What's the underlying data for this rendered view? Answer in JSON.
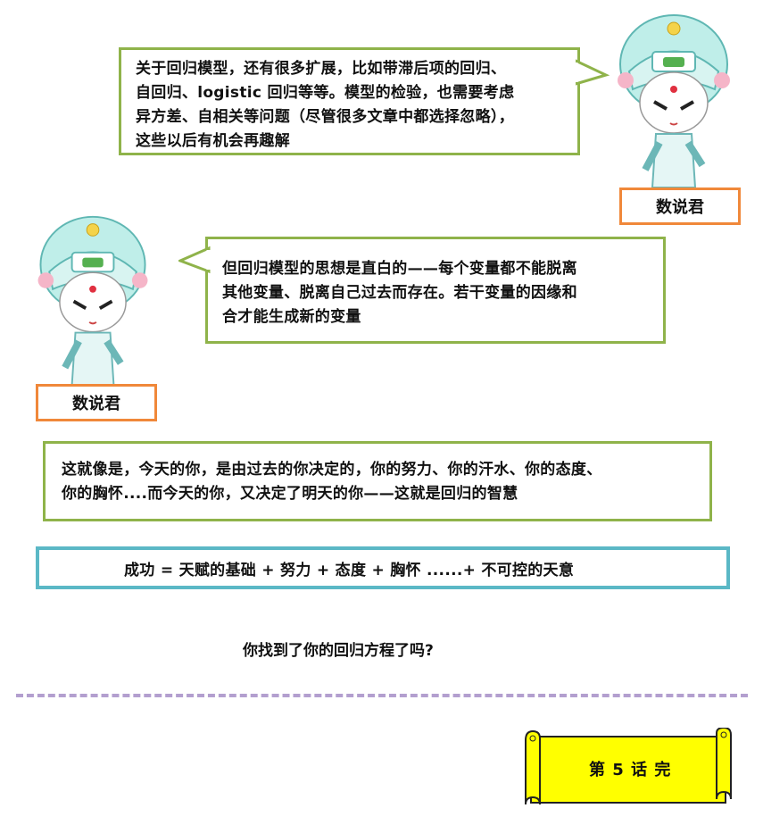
{
  "bubble1": {
    "lines": [
      "关于回归模型，还有很多扩展，比如带滞后项的回归、",
      "自回归、logistic 回归等等。模型的检验，也需要考虑",
      "异方差、自相关等问题（尽管很多文章中都选择忽略），",
      "这些以后有机会再趣解"
    ]
  },
  "speaker1": "数说君",
  "bubble2": {
    "lines": [
      "但回归模型的思想是直白的——每个变量都不能脱离",
      "其他变量、脱离自己过去而存在。若干变量的因缘和",
      "合才能生成新的变量"
    ]
  },
  "speaker2": "数说君",
  "bubble3": {
    "lines": [
      "这就像是，今天的你，是由过去的你决定的，你的努力、你的汗水、你的态度、",
      "你的胸怀....而今天的你，又决定了明天的你——这就是回归的智慧"
    ]
  },
  "formula": "成功 = 天赋的基础 + 努力 + 态度 + 胸怀 ......+ 不可控的天意",
  "question": "你找到了你的回归方程了吗?",
  "scroll": "第 5 话 完",
  "colors": {
    "bubble_border": "#8fb34a",
    "tag_border": "#f0883a",
    "formula_border": "#5bb8c6",
    "divider": "#b39fcf",
    "scroll_fill": "#ffff00"
  },
  "icons": [
    "opera-character-icon",
    "opera-character-icon",
    "scroll-icon"
  ]
}
